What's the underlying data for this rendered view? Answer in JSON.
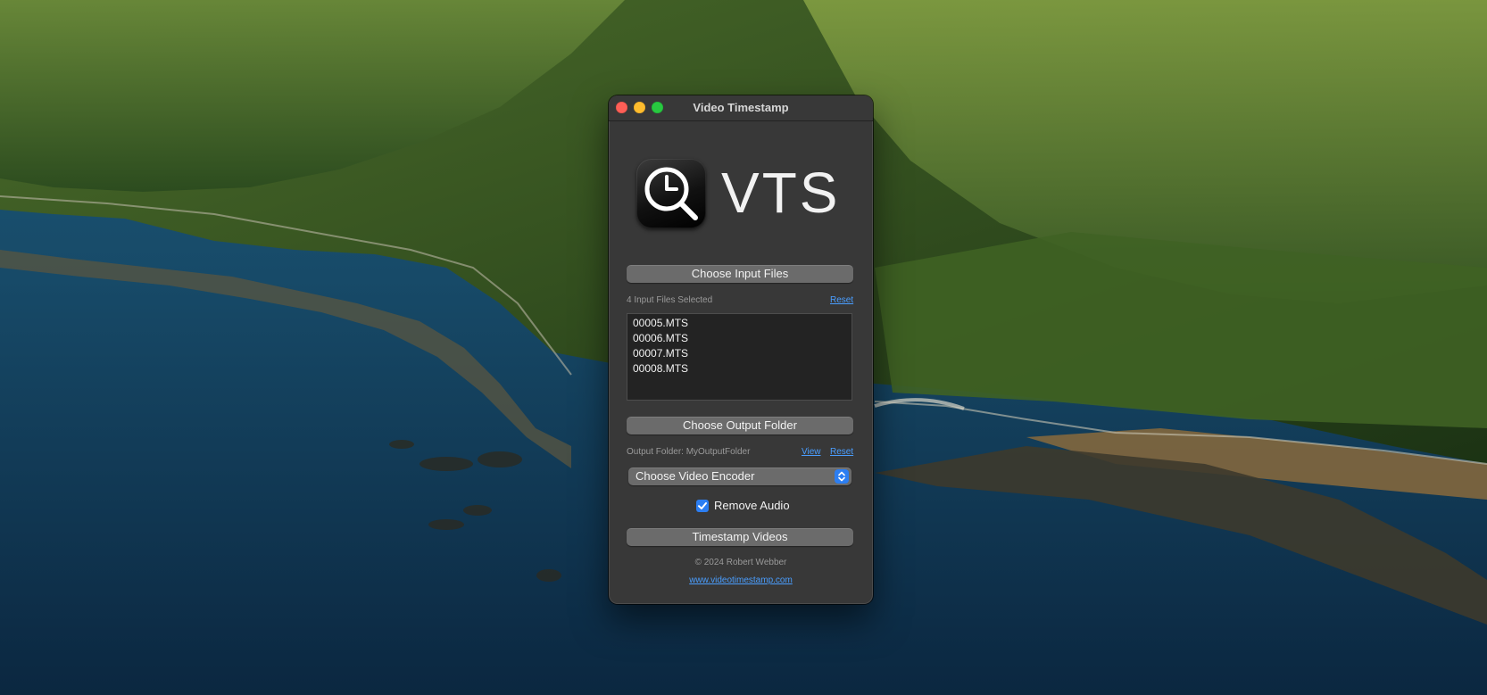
{
  "window": {
    "title": "Video Timestamp"
  },
  "logo": {
    "text": "VTS",
    "icon": "clock-magnifier-icon"
  },
  "input": {
    "choose_button": "Choose Input Files",
    "status": "4 Input Files Selected",
    "reset_label": "Reset",
    "files": [
      "00005.MTS",
      "00006.MTS",
      "00007.MTS",
      "00008.MTS"
    ]
  },
  "output": {
    "choose_button": "Choose Output Folder",
    "status": "Output Folder: MyOutputFolder",
    "view_label": "View",
    "reset_label": "Reset"
  },
  "encoder": {
    "selected": "Choose Video Encoder"
  },
  "audio": {
    "label": "Remove Audio",
    "checked": true
  },
  "actions": {
    "timestamp_button": "Timestamp Videos"
  },
  "footer": {
    "copyright": "© 2024 Robert Webber",
    "website": "www.videotimestamp.com"
  },
  "colors": {
    "accent": "#2c7ef2",
    "link": "#4a9eff",
    "window_bg": "#383838"
  }
}
